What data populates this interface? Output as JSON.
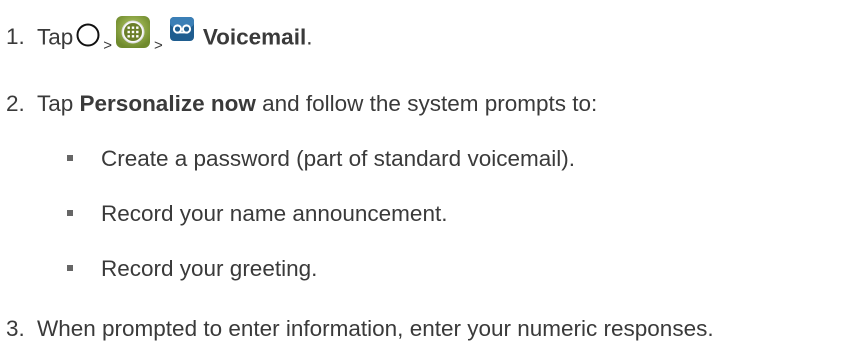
{
  "steps": [
    {
      "number": "1.",
      "prefix": "Tap",
      "separator": ">",
      "icons": [
        "home-circle-icon",
        "apps-grid-icon",
        "voicemail-icon"
      ],
      "target": "Voicemail",
      "suffix": "."
    },
    {
      "number": "2.",
      "prefix": "Tap ",
      "bold": "Personalize now",
      "suffix": " and follow the system prompts to:",
      "bullets": [
        "Create a password (part of standard voicemail).",
        "Record your name announcement.",
        "Record your greeting."
      ]
    },
    {
      "number": "3.",
      "text": "When prompted to enter information, enter your numeric responses."
    }
  ],
  "colors": {
    "text": "#3a3a3a",
    "voicemail_icon_bg": "#1f5d8f",
    "apps_icon_bg": "#8ea44a"
  }
}
